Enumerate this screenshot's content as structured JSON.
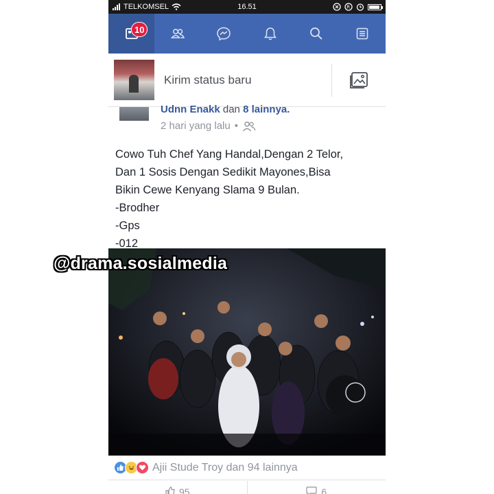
{
  "status_bar": {
    "carrier": "TELKOMSEL",
    "time": "16.51"
  },
  "navbar": {
    "notification_badge": "10",
    "icons": [
      "news-feed-icon",
      "friends-icon",
      "messenger-icon",
      "notifications-icon",
      "search-icon",
      "menu-icon"
    ]
  },
  "composer": {
    "placeholder": "Kirim status baru"
  },
  "post": {
    "author_partial": "Udnn Enakk",
    "author_connector": " dan ",
    "others": "8 lainnya.",
    "time": "2 hari yang lalu",
    "separator": "•",
    "text_lines": [
      "Cowo Tuh Chef Yang Handal,Dengan 2 Telor,",
      "Dan 1 Sosis Dengan Sedikit Mayones,Bisa",
      "Bikin Cewe Kenyang Slama 9 Bulan.",
      "-Brodher",
      "-Gps",
      "-012"
    ]
  },
  "reactions": {
    "summary": "Ajii Stude Troy dan 94 lainnya"
  },
  "actions": {
    "like_count": "95",
    "comment_count": "6"
  },
  "watermark": "@drama.sosialmedia",
  "colors": {
    "navbar": "#4267b2",
    "navbar_active": "#365899",
    "badge": "#e41e3f",
    "link": "#365899"
  }
}
